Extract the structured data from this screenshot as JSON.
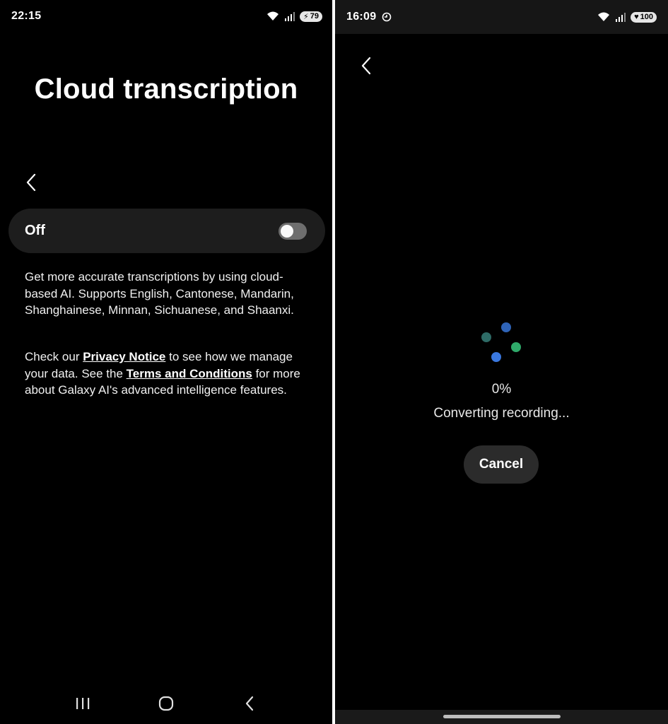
{
  "left": {
    "status": {
      "time": "22:15",
      "battery": "79"
    },
    "title": "Cloud transcription",
    "toggle": {
      "label": "Off",
      "state": "off"
    },
    "description": "Get more accurate transcriptions by using cloud-based AI. Supports English, Cantonese, Mandarin, Shanghainese, Minnan, Sichuanese, and Shaanxi.",
    "notice": {
      "prefix": "Check our ",
      "privacy_link": "Privacy Notice",
      "middle": " to see how we manage your data. See the ",
      "terms_link": "Terms and Conditions",
      "suffix": " for more about Galaxy AI's advanced intelligence features."
    },
    "navbar": [
      "recents-icon",
      "home-icon",
      "back-icon"
    ]
  },
  "right": {
    "status": {
      "time": "16:09",
      "battery": "100"
    },
    "progress": "0%",
    "status_text": "Converting recording...",
    "cancel_label": "Cancel",
    "spinner_colors": [
      "#2e6b66",
      "#2f64b8",
      "#2faa6a",
      "#3a78e0"
    ]
  }
}
